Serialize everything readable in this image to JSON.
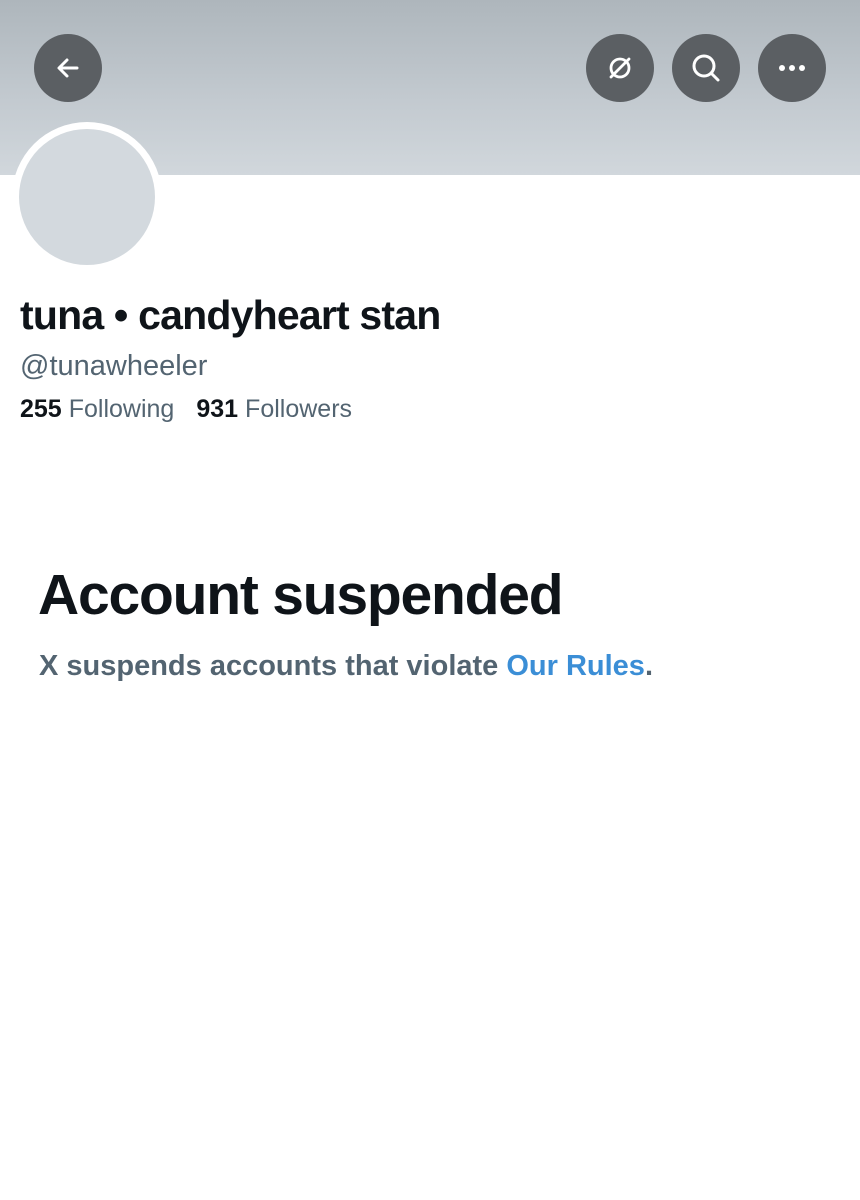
{
  "header": {
    "back_icon": "arrow-left-icon",
    "grok_icon": "grok-icon",
    "search_icon": "search-icon",
    "more_icon": "more-horizontal-icon"
  },
  "profile": {
    "display_name": "tuna • candyheart stan",
    "handle": "@tunawheeler",
    "following_count": "255",
    "following_label": "Following",
    "followers_count": "931",
    "followers_label": "Followers"
  },
  "suspension": {
    "title": "Account suspended",
    "message_prefix": "X suspends accounts that violate ",
    "link_text": "Our Rules",
    "message_suffix": "."
  },
  "colors": {
    "primary_text": "#0f1419",
    "secondary_text": "#536471",
    "link": "#3b8ed6",
    "banner": "#c2c9cf",
    "avatar_placeholder": "#d3d9de",
    "header_button": "#5b5f63"
  }
}
